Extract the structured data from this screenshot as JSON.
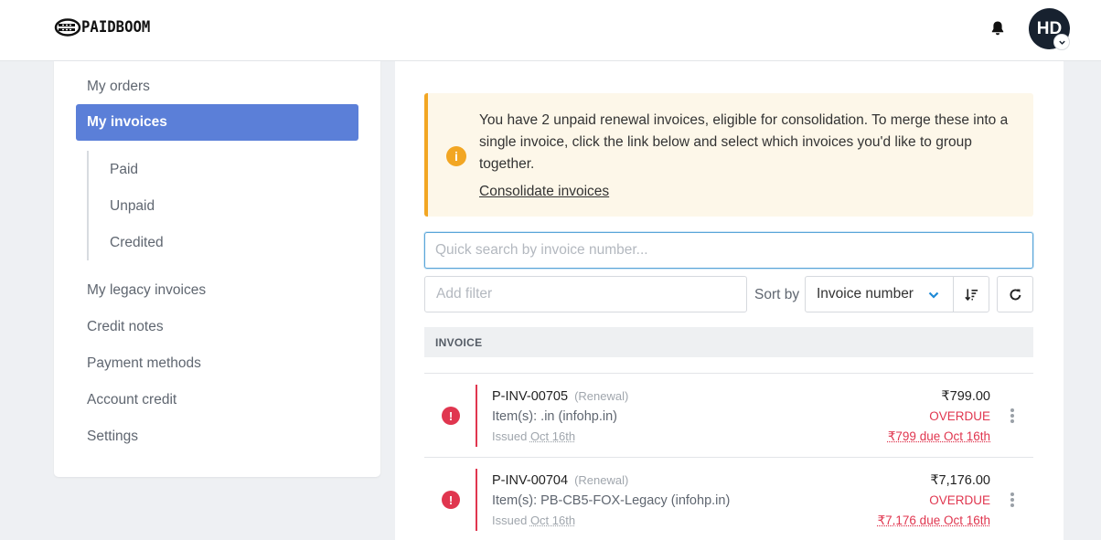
{
  "header": {
    "logo_text": "PAIDBOOM",
    "avatar_initials": "HD"
  },
  "sidebar": {
    "items": [
      {
        "label": "My orders"
      },
      {
        "label": "My invoices"
      },
      {
        "label": "My legacy invoices"
      },
      {
        "label": "Credit notes"
      },
      {
        "label": "Payment methods"
      },
      {
        "label": "Account credit"
      },
      {
        "label": "Settings"
      }
    ],
    "subitems": [
      {
        "label": "Paid"
      },
      {
        "label": "Unpaid"
      },
      {
        "label": "Credited"
      }
    ]
  },
  "main": {
    "alert": {
      "text": "You have 2 unpaid renewal invoices, eligible for consolidation. To merge these into a single invoice, click the link below and select which invoices you'd like to group together.",
      "link": "Consolidate invoices"
    },
    "search": {
      "placeholder": "Quick search by invoice number..."
    },
    "filter": {
      "placeholder": "Add filter"
    },
    "sort": {
      "label": "Sort by",
      "selected": "Invoice number"
    },
    "table_header": "INVOICE",
    "invoices": [
      {
        "number": "P-INV-00705",
        "tag": "(Renewal)",
        "items": "Item(s): .in (infohp.in)",
        "issued_prefix": "Issued",
        "issued_date": "Oct 16th",
        "amount": "₹799.00",
        "status": "OVERDUE",
        "due": "₹799 due Oct 16th"
      },
      {
        "number": "P-INV-00704",
        "tag": "(Renewal)",
        "items": "Item(s): PB-CB5-FOX-Legacy (infohp.in)",
        "issued_prefix": "Issued",
        "issued_date": "Oct 16th",
        "amount": "₹7,176.00",
        "status": "OVERDUE",
        "due": "₹7,176 due Oct 16th"
      }
    ]
  },
  "colors": {
    "accent": "#5b7fd8",
    "warning": "#f2a623",
    "danger": "#e0364f",
    "alert_bg": "#fdf7e9"
  }
}
